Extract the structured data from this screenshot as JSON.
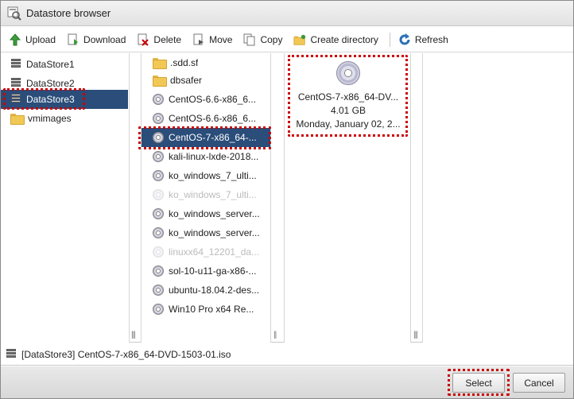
{
  "window": {
    "title": "Datastore browser"
  },
  "toolbar": {
    "upload": "Upload",
    "download": "Download",
    "delete": "Delete",
    "move": "Move",
    "copy": "Copy",
    "create_directory": "Create directory",
    "refresh": "Refresh"
  },
  "datastores": [
    {
      "label": "DataStore1",
      "icon": "datastore-icon"
    },
    {
      "label": "DataStore2",
      "icon": "datastore-icon"
    },
    {
      "label": "DataStore3",
      "icon": "datastore-icon",
      "selected": true
    },
    {
      "label": "vmimages",
      "icon": "folder-icon"
    }
  ],
  "files": [
    {
      "label": ".sdd.sf",
      "icon": "folder-icon"
    },
    {
      "label": "dbsafer",
      "icon": "folder-icon"
    },
    {
      "label": "CentOS-6.6-x86_6...",
      "icon": "disc-icon"
    },
    {
      "label": "CentOS-6.6-x86_6...",
      "icon": "disc-icon"
    },
    {
      "label": "CentOS-7-x86_64-...",
      "icon": "disc-icon",
      "selected": true
    },
    {
      "label": "kali-linux-lxde-2018...",
      "icon": "disc-icon"
    },
    {
      "label": "ko_windows_7_ulti...",
      "icon": "disc-icon"
    },
    {
      "label": "ko_windows_7_ulti...",
      "icon": "disc-icon",
      "faded": true
    },
    {
      "label": "ko_windows_server...",
      "icon": "disc-icon"
    },
    {
      "label": "ko_windows_server...",
      "icon": "disc-icon"
    },
    {
      "label": "linuxx64_12201_da...",
      "icon": "disc-icon",
      "faded": true
    },
    {
      "label": "sol-10-u11-ga-x86-...",
      "icon": "disc-icon"
    },
    {
      "label": "ubuntu-18.04.2-des...",
      "icon": "disc-icon"
    },
    {
      "label": "Win10 Pro x64 Re...",
      "icon": "disc-icon"
    }
  ],
  "preview": {
    "name": "CentOS-7-x86_64-DV...",
    "size": "4.01 GB",
    "date": "Monday, January 02, 2..."
  },
  "status": {
    "path": "[DataStore3] CentOS-7-x86_64-DVD-1503-01.iso"
  },
  "footer": {
    "select": "Select",
    "cancel": "Cancel"
  },
  "colors": {
    "selection": "#2a4d7a",
    "highlight": "#cc0000",
    "refresh": "#2a6fb8",
    "upload": "#3a9b3a"
  }
}
